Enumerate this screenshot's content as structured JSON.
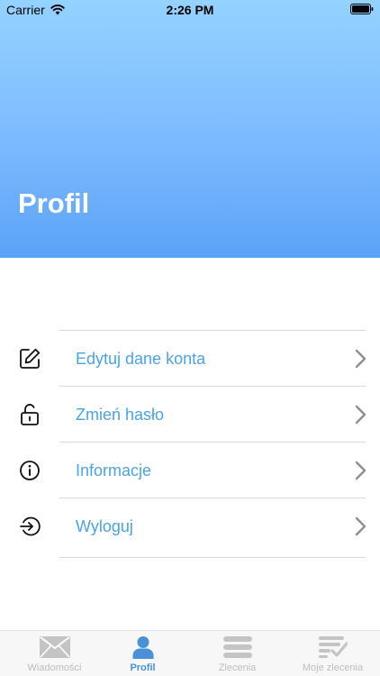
{
  "status_bar": {
    "carrier": "Carrier",
    "time": "2:26 PM"
  },
  "header": {
    "title": "Profil"
  },
  "menu": {
    "items": [
      {
        "label": "Edytuj dane konta",
        "icon": "edit-icon"
      },
      {
        "label": "Zmień hasło",
        "icon": "unlock-icon"
      },
      {
        "label": "Informacje",
        "icon": "info-icon"
      },
      {
        "label": "Wyloguj",
        "icon": "logout-icon"
      }
    ]
  },
  "tabbar": {
    "active": 1,
    "tabs": [
      {
        "label": "Wiadomości",
        "icon": "envelope-icon"
      },
      {
        "label": "Profil",
        "icon": "person-icon"
      },
      {
        "label": "Zlecenia",
        "icon": "list-icon"
      },
      {
        "label": "Moje zlecenia",
        "icon": "checklist-icon"
      }
    ]
  },
  "colors": {
    "header_top": "#94d2ff",
    "header_bottom": "#5ba2f7",
    "menu_text": "#4aa3e6",
    "tab_active": "#4a90d9",
    "tab_inactive": "#bdbdbd"
  }
}
